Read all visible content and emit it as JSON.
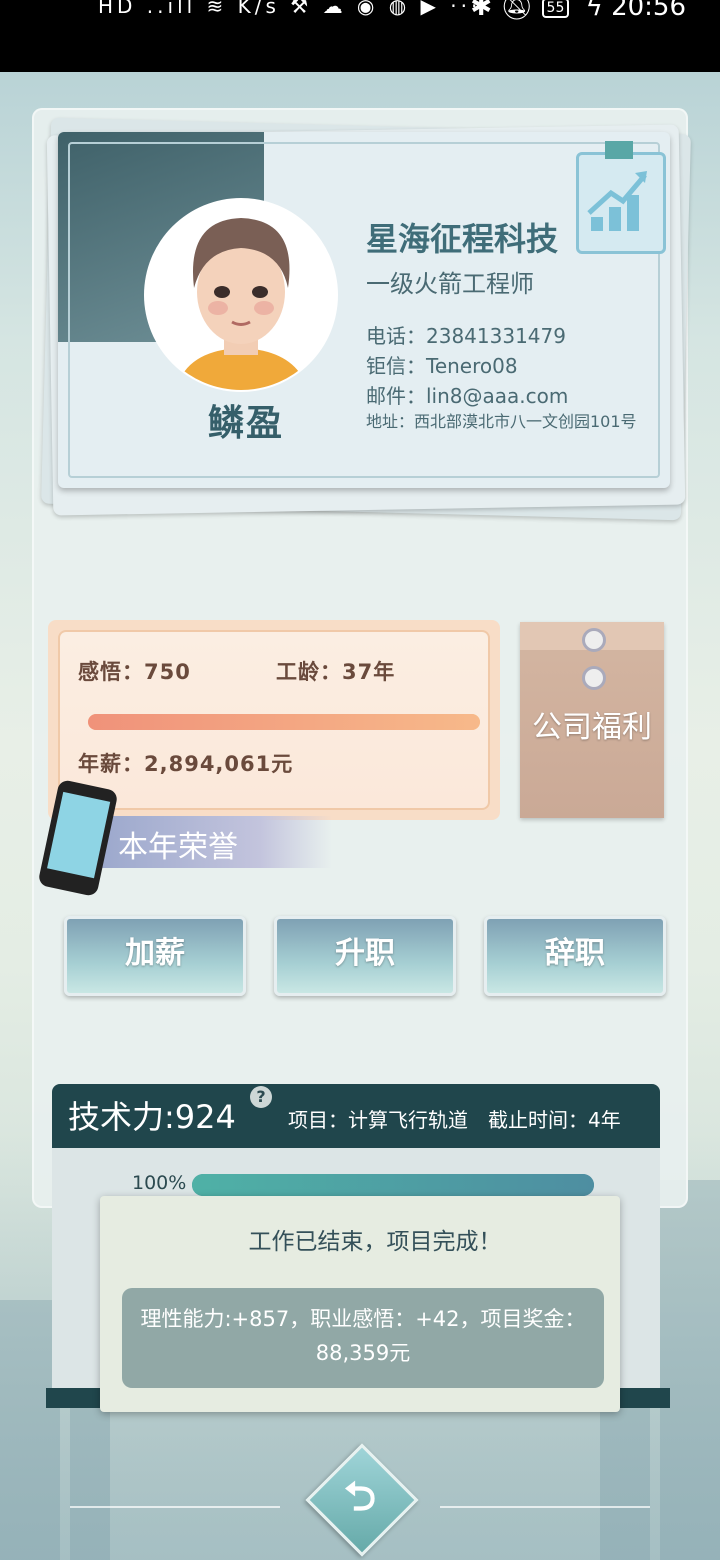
{
  "status_bar": {
    "left_icons": "HD ..ıll ≋ K/s ⚒ ☁ ◉ ◍ ▶ ···",
    "battery": "55",
    "time": "20:56"
  },
  "card": {
    "company": "星海征程科技",
    "role": "一级火箭工程师",
    "phone": "电话：23841331479",
    "message_id": "钜信：Tenero08",
    "email": "邮件：lin8@aaa.com",
    "address": "地址：西北部漠北市八一文创园101号",
    "name": "鳞盈"
  },
  "stats": {
    "insight": "感悟：750",
    "seniority": "工龄：37年",
    "salary": "年薪：2,894,061元",
    "bar_fraction": 1.0
  },
  "welfare_label": "公司福利",
  "honor_label": "本年荣誉",
  "actions": {
    "raise": "加薪",
    "promote": "升职",
    "resign": "辞职"
  },
  "project": {
    "tech_power": "技术力:924",
    "help": "?",
    "info": "项目：计算飞行轨道　截止时间：4年",
    "progress_label": "100%",
    "progress": 1.0
  },
  "popup": {
    "title": "工作已结束，项目完成！",
    "message": "理性能力:+857，职业感悟：+42，项目奖金：88,359元"
  },
  "back_icon": "back-arrow-icon"
}
